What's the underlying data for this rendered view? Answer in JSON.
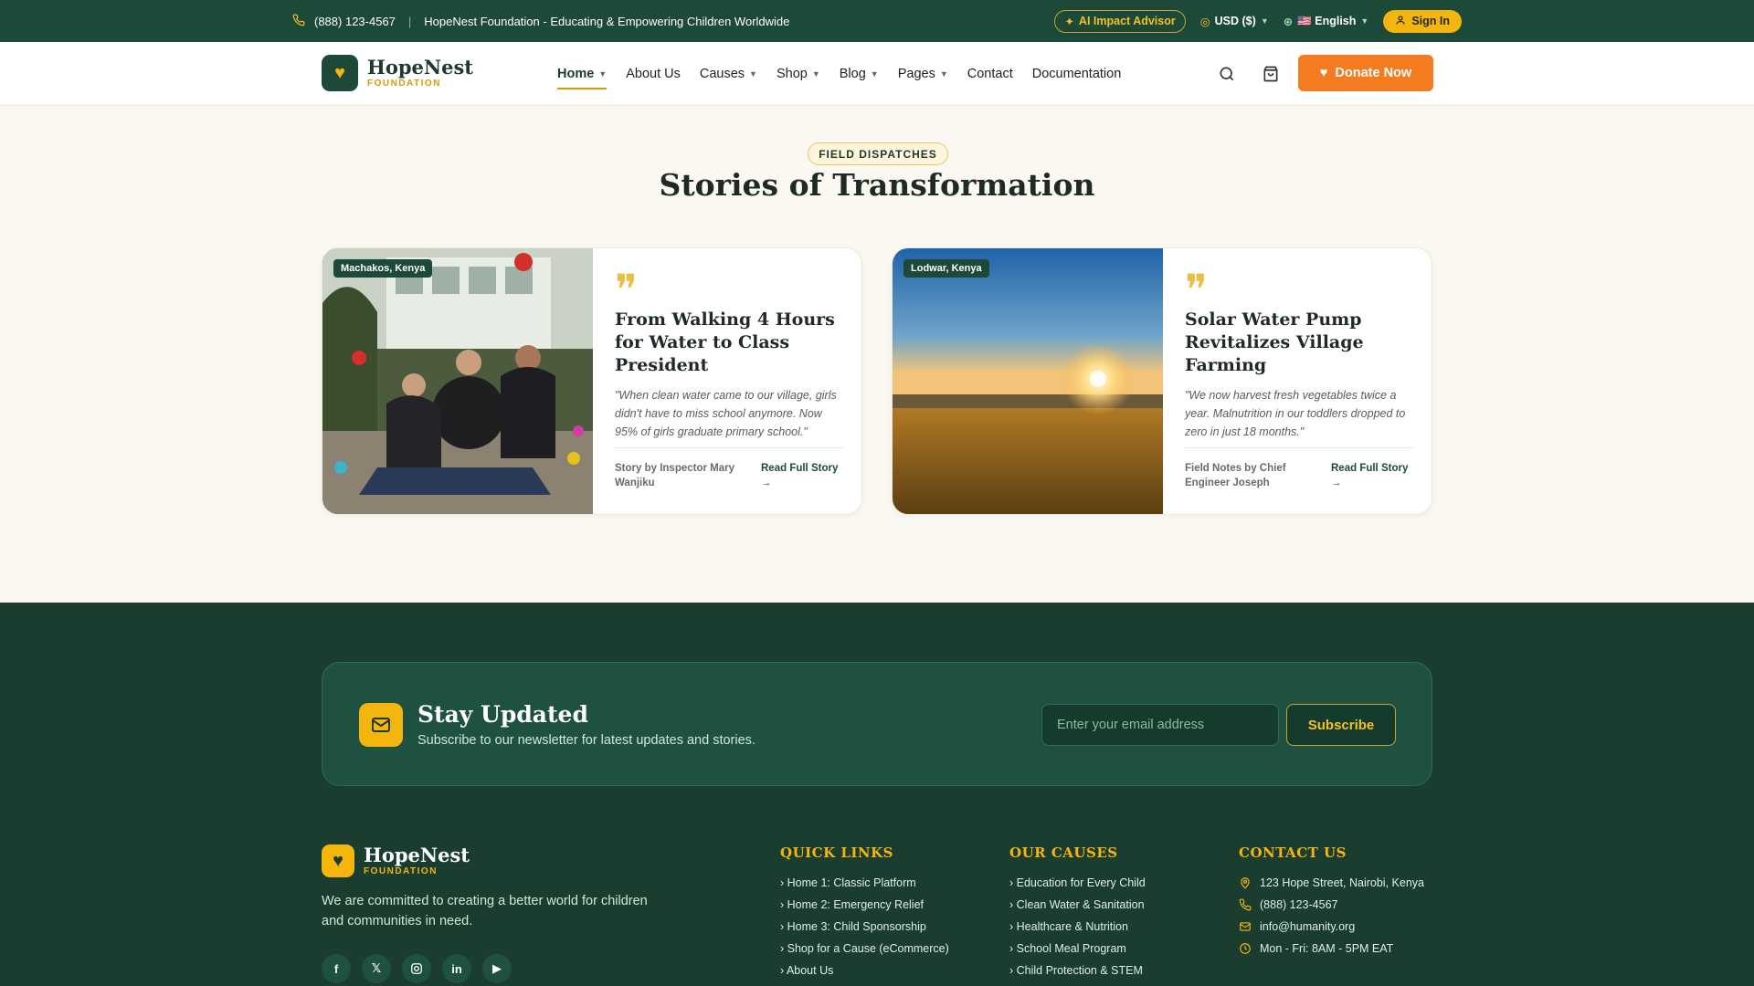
{
  "topbar": {
    "phone": "(888) 123-4567",
    "tagline": "HopeNest Foundation - Educating & Empowering Children Worldwide",
    "ai_advisor": "AI Impact Advisor",
    "currency": "USD ($)",
    "language": "🇺🇸 English",
    "sign_in": "Sign In"
  },
  "header": {
    "logo_name": "HopeNest",
    "logo_sub": "FOUNDATION",
    "nav": [
      {
        "label": "Home"
      },
      {
        "label": "About Us"
      },
      {
        "label": "Causes"
      },
      {
        "label": "Shop"
      },
      {
        "label": "Blog"
      },
      {
        "label": "Pages"
      },
      {
        "label": "Contact"
      },
      {
        "label": "Documentation"
      }
    ],
    "donate": "Donate Now"
  },
  "section": {
    "badge": "FIELD DISPATCHES",
    "title": "Stories of Transformation"
  },
  "stories": [
    {
      "location": "Machakos, Kenya",
      "title": "From Walking 4 Hours for Water to Class President",
      "quote": "\"When clean water came to our village, girls didn't have to miss school anymore. Now 95% of girls graduate primary school.\"",
      "byline": "Story by Inspector Mary Wanjiku",
      "read": "Read Full Story →"
    },
    {
      "location": "Lodwar, Kenya",
      "title": "Solar Water Pump Revitalizes Village Farming",
      "quote": "\"We now harvest fresh vegetables twice a year. Malnutrition in our toddlers dropped to zero in just 18 months.\"",
      "byline": "Field Notes by Chief Engineer Joseph",
      "read": "Read Full Story →"
    }
  ],
  "newsletter": {
    "title": "Stay Updated",
    "subtitle": "Subscribe to our newsletter for latest updates and stories.",
    "placeholder": "Enter your email address",
    "button": "Subscribe"
  },
  "footer": {
    "logo_name": "HopeNest",
    "logo_sub": "FOUNDATION",
    "description": "We are committed to creating a better world for children and communities in need.",
    "quick_links_title": "QUICK LINKS",
    "quick_links": [
      "› Home 1: Classic Platform",
      "› Home 2: Emergency Relief",
      "› Home 3: Child Sponsorship",
      "› Shop for a Cause (eCommerce)",
      "› About Us"
    ],
    "causes_title": "OUR CAUSES",
    "causes": [
      "› Education for Every Child",
      "› Clean Water & Sanitation",
      "› Healthcare & Nutrition",
      "› School Meal Program",
      "› Child Protection & STEM"
    ],
    "contact_title": "CONTACT US",
    "contact": {
      "address": "123 Hope Street, Nairobi, Kenya",
      "phone": "(888) 123-4567",
      "email": "info@humanity.org",
      "hours": "Mon - Fri: 8AM - 5PM EAT"
    },
    "socials": [
      "facebook-icon",
      "x-icon",
      "instagram-icon",
      "linkedin-icon",
      "youtube-icon"
    ]
  },
  "colors": {
    "primary_green": "#1d4a38",
    "accent_yellow": "#f4b50c",
    "donate_orange": "#f47b20",
    "footer_bg": "#1a3d30"
  }
}
